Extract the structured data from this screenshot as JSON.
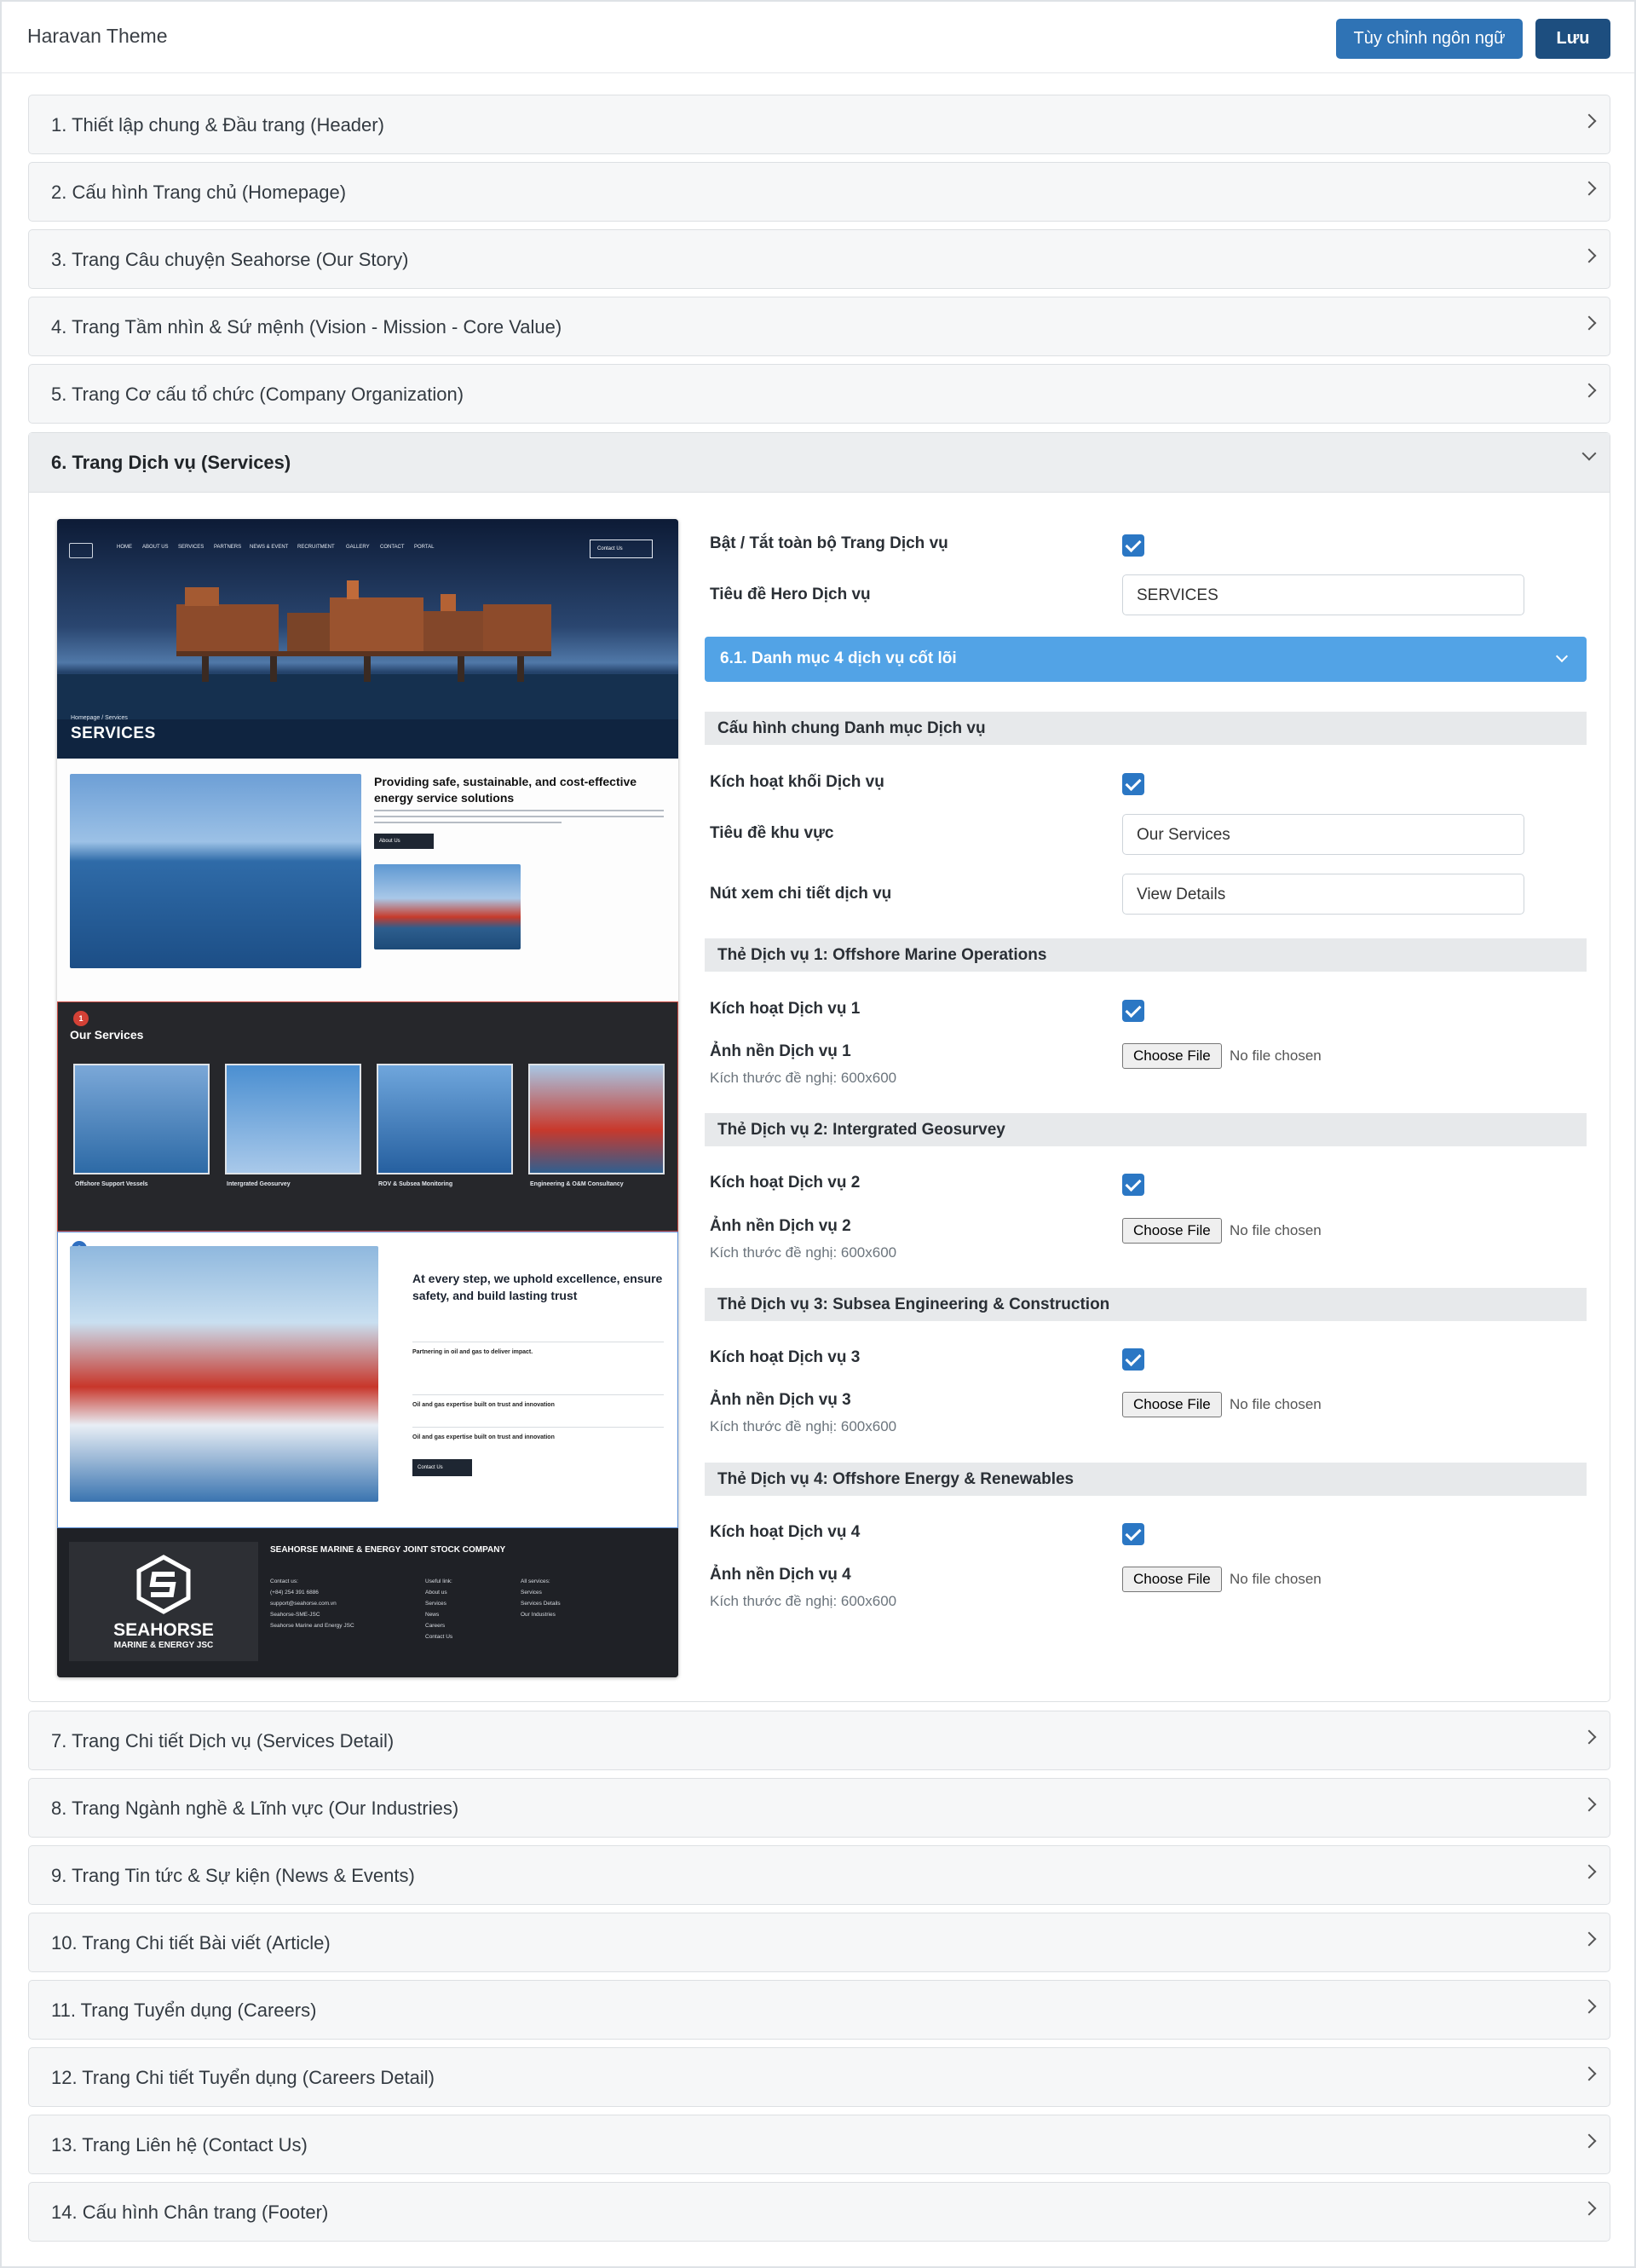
{
  "app": {
    "title": "Haravan Theme"
  },
  "toolbar": {
    "lang_label": "Tùy chỉnh ngôn ngữ",
    "save_label": "Lưu"
  },
  "sections_top": [
    "1. Thiết lập chung & Đầu trang (Header)",
    "2. Cấu hình Trang chủ (Homepage)",
    "3. Trang Câu chuyện Seahorse (Our Story)",
    "4. Trang Tầm nhìn & Sứ mệnh (Vision - Mission - Core Value)",
    "5. Trang Cơ cấu tổ chức (Company Organization)"
  ],
  "open_section": {
    "label": "6. Trang Dịch vụ (Services)"
  },
  "sections_bottom": [
    "7. Trang Chi tiết Dịch vụ (Services Detail)",
    "8. Trang Ngành nghề & Lĩnh vực (Our Industries)",
    "9. Trang Tin tức & Sự kiện (News & Events)",
    "10. Trang Chi tiết Bài viết (Article)",
    "11. Trang Tuyển dụng (Careers)",
    "12. Trang Chi tiết Tuyển dụng (Careers Detail)",
    "13. Trang Liên hệ (Contact Us)",
    "14. Cấu hình Chân trang (Footer)"
  ],
  "preview": {
    "nav": [
      "HOME",
      "ABOUT US",
      "SERVICES",
      "PARTNERS",
      "NEWS & EVENT",
      "RECRUITMENT",
      "GALLERY",
      "CONTACT",
      "PORTAL"
    ],
    "contact_btn": "Contact Us",
    "breadcrumb": "Homepage / Services",
    "hero_title": "SERVICES",
    "about_heading": "Providing safe, sustainable, and cost-effective energy service solutions",
    "about_btn": "About Us",
    "services_title": "Our Services",
    "badge1": "1",
    "badge2": "2",
    "cards": [
      "Offshore Support Vessels",
      "Intergrated Geosurvey",
      "ROV & Subsea Monitoring",
      "Engineering & O&M Consultancy"
    ],
    "why_heading": "At every step, we uphold excellence, ensure safety, and build lasting trust",
    "why_rows": [
      "Partnering in oil and gas to deliver impact.",
      "Oil and gas expertise built on trust and innovation",
      "Oil and gas expertise built on trust and innovation"
    ],
    "why_btn": "Contact Us",
    "footer_company": "SEAHORSE MARINE & ENERGY JOINT STOCK COMPANY",
    "footer_brand": "SEAHORSE",
    "footer_brand_sub": "MARINE & ENERGY JSC",
    "footer_contact": [
      "Contact us:",
      "(+84) 254 391 6886",
      "support@seahorse.com.vn",
      "Seahorse-SME-JSC",
      "Seahorse Marine and Energy JSC"
    ],
    "footer_links": [
      "Useful link:",
      "About us",
      "Services",
      "News",
      "Careers",
      "Contact Us"
    ],
    "footer_services": [
      "All services:",
      "Services",
      "Services Details",
      "Our Industries"
    ]
  },
  "form": {
    "toggle_all_label": "Bật / Tắt toàn bộ Trang Dịch vụ",
    "hero_title_label": "Tiêu đề Hero Dịch vụ",
    "hero_title_value": "SERVICES",
    "sub_section": "6.1. Danh mục 4 dịch vụ cốt lõi",
    "general_bar": "Cấu hình chung Danh mục Dịch vụ",
    "enable_block_label": "Kích hoạt khối Dịch vụ",
    "area_title_label": "Tiêu đề khu vực",
    "area_title_value": "Our Services",
    "detail_btn_label": "Nút xem chi tiết dịch vụ",
    "detail_btn_value": "View Details",
    "size_hint": "Kích thước đề nghị: 600x600",
    "file_btn": "Choose File",
    "file_none": "No file chosen",
    "services": [
      {
        "bar": "Thẻ Dịch vụ 1: Offshore Marine Operations",
        "enable": "Kích hoạt Dịch vụ 1",
        "image": "Ảnh nền Dịch vụ 1"
      },
      {
        "bar": "Thẻ Dịch vụ 2: Intergrated Geosurvey",
        "enable": "Kích hoạt Dịch vụ 2",
        "image": "Ảnh nền Dịch vụ 2"
      },
      {
        "bar": "Thẻ Dịch vụ 3: Subsea Engineering & Construction",
        "enable": "Kích hoạt Dịch vụ 3",
        "image": "Ảnh nền Dịch vụ 3"
      },
      {
        "bar": "Thẻ Dịch vụ 4: Offshore Energy & Renewables",
        "enable": "Kích hoạt Dịch vụ 4",
        "image": "Ảnh nền Dịch vụ 4"
      }
    ]
  },
  "colors": {
    "primary": "#2f73b5",
    "save": "#1d4e7f",
    "sub_accordion": "#52a3e6",
    "checkbox": "#2b77c4"
  }
}
